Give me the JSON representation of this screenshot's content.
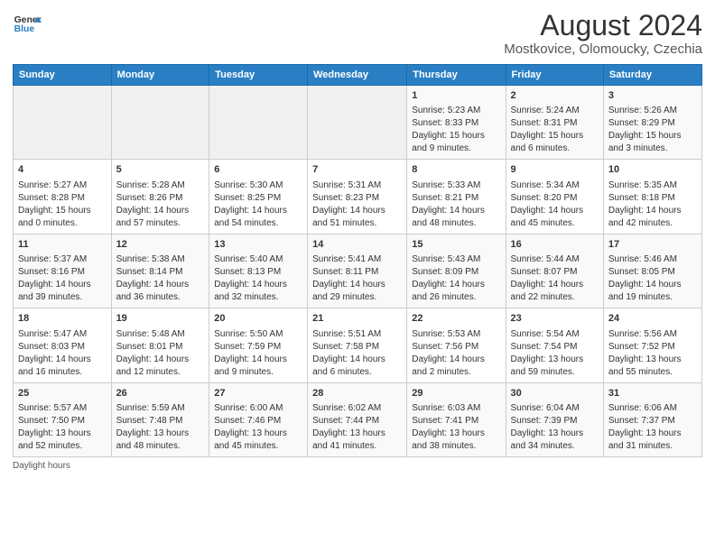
{
  "header": {
    "logo_line1": "General",
    "logo_line2": "Blue",
    "month_title": "August 2024",
    "location": "Mostkovice, Olomoucky, Czechia"
  },
  "days_of_week": [
    "Sunday",
    "Monday",
    "Tuesday",
    "Wednesday",
    "Thursday",
    "Friday",
    "Saturday"
  ],
  "weeks": [
    [
      {
        "day": "",
        "info": ""
      },
      {
        "day": "",
        "info": ""
      },
      {
        "day": "",
        "info": ""
      },
      {
        "day": "",
        "info": ""
      },
      {
        "day": "1",
        "info": "Sunrise: 5:23 AM\nSunset: 8:33 PM\nDaylight: 15 hours\nand 9 minutes."
      },
      {
        "day": "2",
        "info": "Sunrise: 5:24 AM\nSunset: 8:31 PM\nDaylight: 15 hours\nand 6 minutes."
      },
      {
        "day": "3",
        "info": "Sunrise: 5:26 AM\nSunset: 8:29 PM\nDaylight: 15 hours\nand 3 minutes."
      }
    ],
    [
      {
        "day": "4",
        "info": "Sunrise: 5:27 AM\nSunset: 8:28 PM\nDaylight: 15 hours\nand 0 minutes."
      },
      {
        "day": "5",
        "info": "Sunrise: 5:28 AM\nSunset: 8:26 PM\nDaylight: 14 hours\nand 57 minutes."
      },
      {
        "day": "6",
        "info": "Sunrise: 5:30 AM\nSunset: 8:25 PM\nDaylight: 14 hours\nand 54 minutes."
      },
      {
        "day": "7",
        "info": "Sunrise: 5:31 AM\nSunset: 8:23 PM\nDaylight: 14 hours\nand 51 minutes."
      },
      {
        "day": "8",
        "info": "Sunrise: 5:33 AM\nSunset: 8:21 PM\nDaylight: 14 hours\nand 48 minutes."
      },
      {
        "day": "9",
        "info": "Sunrise: 5:34 AM\nSunset: 8:20 PM\nDaylight: 14 hours\nand 45 minutes."
      },
      {
        "day": "10",
        "info": "Sunrise: 5:35 AM\nSunset: 8:18 PM\nDaylight: 14 hours\nand 42 minutes."
      }
    ],
    [
      {
        "day": "11",
        "info": "Sunrise: 5:37 AM\nSunset: 8:16 PM\nDaylight: 14 hours\nand 39 minutes."
      },
      {
        "day": "12",
        "info": "Sunrise: 5:38 AM\nSunset: 8:14 PM\nDaylight: 14 hours\nand 36 minutes."
      },
      {
        "day": "13",
        "info": "Sunrise: 5:40 AM\nSunset: 8:13 PM\nDaylight: 14 hours\nand 32 minutes."
      },
      {
        "day": "14",
        "info": "Sunrise: 5:41 AM\nSunset: 8:11 PM\nDaylight: 14 hours\nand 29 minutes."
      },
      {
        "day": "15",
        "info": "Sunrise: 5:43 AM\nSunset: 8:09 PM\nDaylight: 14 hours\nand 26 minutes."
      },
      {
        "day": "16",
        "info": "Sunrise: 5:44 AM\nSunset: 8:07 PM\nDaylight: 14 hours\nand 22 minutes."
      },
      {
        "day": "17",
        "info": "Sunrise: 5:46 AM\nSunset: 8:05 PM\nDaylight: 14 hours\nand 19 minutes."
      }
    ],
    [
      {
        "day": "18",
        "info": "Sunrise: 5:47 AM\nSunset: 8:03 PM\nDaylight: 14 hours\nand 16 minutes."
      },
      {
        "day": "19",
        "info": "Sunrise: 5:48 AM\nSunset: 8:01 PM\nDaylight: 14 hours\nand 12 minutes."
      },
      {
        "day": "20",
        "info": "Sunrise: 5:50 AM\nSunset: 7:59 PM\nDaylight: 14 hours\nand 9 minutes."
      },
      {
        "day": "21",
        "info": "Sunrise: 5:51 AM\nSunset: 7:58 PM\nDaylight: 14 hours\nand 6 minutes."
      },
      {
        "day": "22",
        "info": "Sunrise: 5:53 AM\nSunset: 7:56 PM\nDaylight: 14 hours\nand 2 minutes."
      },
      {
        "day": "23",
        "info": "Sunrise: 5:54 AM\nSunset: 7:54 PM\nDaylight: 13 hours\nand 59 minutes."
      },
      {
        "day": "24",
        "info": "Sunrise: 5:56 AM\nSunset: 7:52 PM\nDaylight: 13 hours\nand 55 minutes."
      }
    ],
    [
      {
        "day": "25",
        "info": "Sunrise: 5:57 AM\nSunset: 7:50 PM\nDaylight: 13 hours\nand 52 minutes."
      },
      {
        "day": "26",
        "info": "Sunrise: 5:59 AM\nSunset: 7:48 PM\nDaylight: 13 hours\nand 48 minutes."
      },
      {
        "day": "27",
        "info": "Sunrise: 6:00 AM\nSunset: 7:46 PM\nDaylight: 13 hours\nand 45 minutes."
      },
      {
        "day": "28",
        "info": "Sunrise: 6:02 AM\nSunset: 7:44 PM\nDaylight: 13 hours\nand 41 minutes."
      },
      {
        "day": "29",
        "info": "Sunrise: 6:03 AM\nSunset: 7:41 PM\nDaylight: 13 hours\nand 38 minutes."
      },
      {
        "day": "30",
        "info": "Sunrise: 6:04 AM\nSunset: 7:39 PM\nDaylight: 13 hours\nand 34 minutes."
      },
      {
        "day": "31",
        "info": "Sunrise: 6:06 AM\nSunset: 7:37 PM\nDaylight: 13 hours\nand 31 minutes."
      }
    ]
  ],
  "footer": "Daylight hours"
}
